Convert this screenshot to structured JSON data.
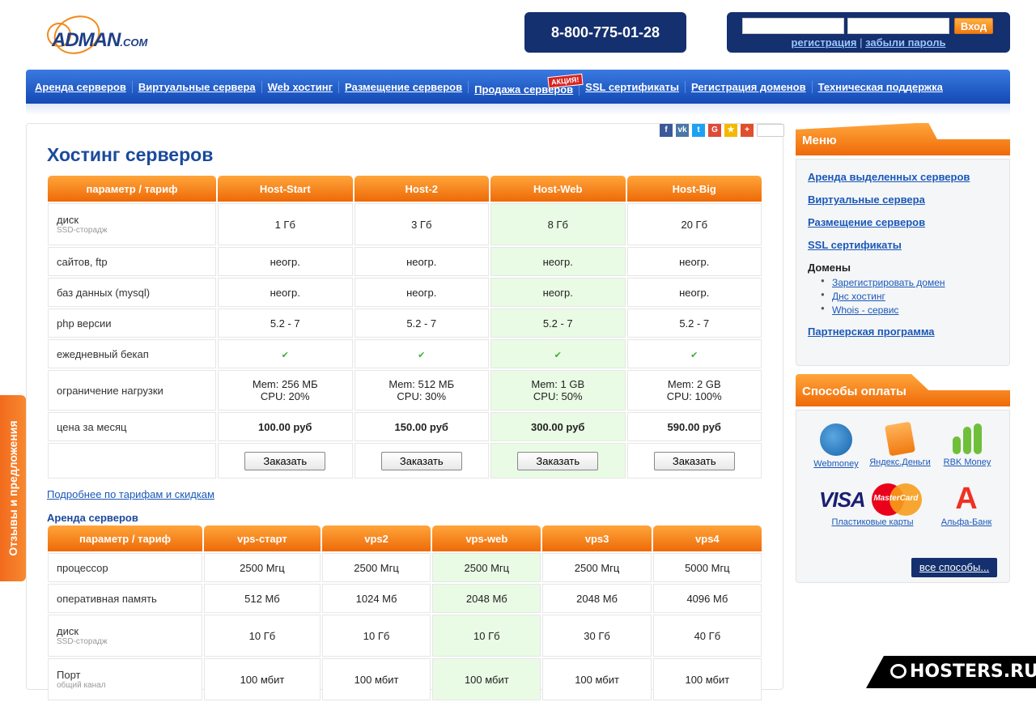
{
  "header": {
    "logo_text": "ADMAN",
    "logo_suffix": ".COM",
    "phone": "8-800-775-01-28",
    "login_button": "Вход",
    "register_link": "регистрация",
    "separator": " | ",
    "forgot_link": "забыли пароль"
  },
  "nav": {
    "items": [
      "Аренда серверов",
      "Виртуальные сервера",
      "Web хостинг",
      "Размещение серверов",
      "Продажа серверов",
      "SSL сертификаты",
      "Регистрация доменов",
      "Техническая поддержка"
    ],
    "promo_badge": "АКЦИЯ!"
  },
  "share": {
    "icons": [
      "facebook-icon",
      "vk-icon",
      "twitter-icon",
      "google-plus-icon",
      "star-icon",
      "plus-icon"
    ]
  },
  "main": {
    "title": "Хостинг серверов",
    "hosting_table": {
      "header_param": "параметр / тариф",
      "columns": [
        "Host-Start",
        "Host-2",
        "Host-Web",
        "Host-Big"
      ],
      "rows": [
        {
          "label": "диск",
          "sub": "SSD-сторадж",
          "values": [
            "1 Гб",
            "3 Гб",
            "8 Гб",
            "20 Гб"
          ]
        },
        {
          "label": "сайтов, ftp",
          "sub": "",
          "values": [
            "неогр.",
            "неогр.",
            "неогр.",
            "неогр."
          ]
        },
        {
          "label": "баз данных (mysql)",
          "sub": "",
          "values": [
            "неогр.",
            "неогр.",
            "неогр.",
            "неогр."
          ]
        },
        {
          "label": "php версии",
          "sub": "",
          "values": [
            "5.2 - 7",
            "5.2 - 7",
            "5.2 - 7",
            "5.2 - 7"
          ]
        },
        {
          "label": "ежедневный бекап",
          "sub": "",
          "values": [
            "✔",
            "✔",
            "✔",
            "✔"
          ]
        },
        {
          "label": "ограничение нагрузки",
          "sub": "",
          "values": [
            "Mem: 256 МБ",
            "Mem: 512 МБ",
            "Mem: 1 GB",
            "Mem: 2 GB"
          ],
          "values2": [
            "CPU: 20%",
            "CPU: 30%",
            "CPU: 50%",
            "CPU: 100%"
          ]
        },
        {
          "label": "цена за месяц",
          "sub": "",
          "values": [
            "100.00 руб",
            "150.00 руб",
            "300.00 руб",
            "590.00 руб"
          ]
        }
      ],
      "order_button": "Заказать"
    },
    "more_link": "Подробнее по тарифам и скидкам",
    "vps_heading": "Аренда серверов",
    "vps_table": {
      "header_param": "параметр / тариф",
      "columns": [
        "vps-старт",
        "vps2",
        "vps-web",
        "vps3",
        "vps4"
      ],
      "rows": [
        {
          "label": "процессор",
          "sub": "",
          "values": [
            "2500 Мгц",
            "2500 Мгц",
            "2500 Мгц",
            "2500 Мгц",
            "5000 Мгц"
          ]
        },
        {
          "label": "оперативная память",
          "sub": "",
          "values": [
            "512 Мб",
            "1024 Мб",
            "2048 Мб",
            "2048 Мб",
            "4096 Мб"
          ]
        },
        {
          "label": "диск",
          "sub": "SSD-сторадж",
          "values": [
            "10 Гб",
            "10 Гб",
            "10 Гб",
            "30 Гб",
            "40 Гб"
          ]
        },
        {
          "label": "Порт",
          "sub": "общий канал",
          "values": [
            "100 мбит",
            "100 мбит",
            "100 мбит",
            "100 мбит",
            "100 мбит"
          ]
        }
      ]
    }
  },
  "sidebar": {
    "menu_title": "Меню",
    "menu_links": [
      "Аренда выделенных серверов",
      "Виртуальные сервера",
      "Размещение серверов",
      "SSL сертификаты"
    ],
    "domains_title": "Домены",
    "domains_links": [
      "Зарегистрировать домен",
      "Днс хостинг",
      "Whois - сервис"
    ],
    "partner_link": "Партнерская программа",
    "payment_title": "Способы оплаты",
    "payments": {
      "webmoney": "Webmoney",
      "yandex": "Яндекс.Деньги",
      "rbk": "RBK Money",
      "cards_visa": "VISA",
      "cards_mc": "MasterCard",
      "cards": "Пластиковые карты",
      "alfa_letter": "А",
      "alfa": "Альфа-Банк"
    },
    "all_ways": "все способы..."
  },
  "feedback_tab": "Отзывы и предложения",
  "watermark": "HOSTERS.RU"
}
